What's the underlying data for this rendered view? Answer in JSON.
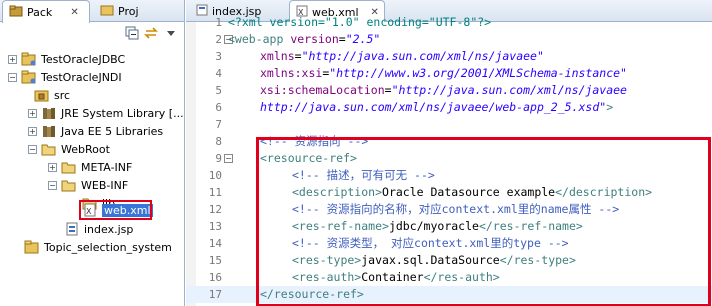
{
  "left_tabs": [
    {
      "label": "Pack",
      "close": "✕"
    },
    {
      "label": "Proj"
    }
  ],
  "tree": [
    {
      "label": "TestOracleJDBC"
    },
    {
      "label": "TestOracleJNDI"
    },
    {
      "label": "src"
    },
    {
      "label": "JRE System Library [..."
    },
    {
      "label": "Java EE 5 Libraries"
    },
    {
      "label": "WebRoot"
    },
    {
      "label": "META-INF"
    },
    {
      "label": "WEB-INF"
    },
    {
      "label": "lib"
    },
    {
      "label": "web.xml"
    },
    {
      "label": "index.jsp"
    },
    {
      "label": "Topic_selection_system"
    }
  ],
  "editor_tabs": [
    {
      "label": "index.jsp"
    },
    {
      "label": "web.xml",
      "close": "✕"
    }
  ],
  "code": {
    "l1": {
      "num": "1",
      "pi": "<?xml version=\"1.0\" encoding=\"UTF-8\"?>"
    },
    "l2": {
      "num": "2",
      "tag": "<web-app",
      "attr": " version",
      "eq": "=",
      "val": "\"2.5\""
    },
    "l3": {
      "num": "3",
      "attr": "xmlns",
      "eq": "=",
      "val": "\"http://java.sun.com/xml/ns/javaee\""
    },
    "l4": {
      "num": "4",
      "attr": "xmlns:xsi",
      "eq": "=",
      "val": "\"http://www.w3.org/2001/XMLSchema-instance\""
    },
    "l5": {
      "num": "5",
      "attr": "xsi:schemaLocation",
      "eq": "=",
      "val": "\"http://java.sun.com/xml/ns/javaee"
    },
    "l6": {
      "num": "6",
      "val": "http://java.sun.com/xml/ns/javaee/web-app_2_5.xsd\"",
      "end": ">"
    },
    "l7": {
      "num": "7"
    },
    "l8": {
      "num": "8",
      "com": "<!-- 资源指向 -->"
    },
    "l9": {
      "num": "9",
      "tag": "<resource-ref>"
    },
    "l10": {
      "num": "10",
      "com": "<!-- 描述，可有可无 -->"
    },
    "l11": {
      "num": "11",
      "open": "<description>",
      "text": "Oracle Datasource example",
      "close": "</description>"
    },
    "l12": {
      "num": "12",
      "com": "<!-- 资源指向的名称，对应context.xml里的name属性 -->"
    },
    "l13": {
      "num": "13",
      "open": "<res-ref-name>",
      "text": "jdbc/myoracle",
      "close": "</res-ref-name>"
    },
    "l14": {
      "num": "14",
      "com": "<!-- 资源类型， 对应context.xml里的type -->"
    },
    "l15": {
      "num": "15",
      "open": "<res-type>",
      "text": "javax.sql.DataSource",
      "close": "</res-type>"
    },
    "l16": {
      "num": "16",
      "open": "<res-auth>",
      "text": "Container",
      "close": "</res-auth>"
    },
    "l17": {
      "num": "17",
      "tag": "</resource-ref>"
    }
  },
  "colors": {
    "highlight_box": "#e0001b",
    "current_line": "#e8f2fe"
  }
}
